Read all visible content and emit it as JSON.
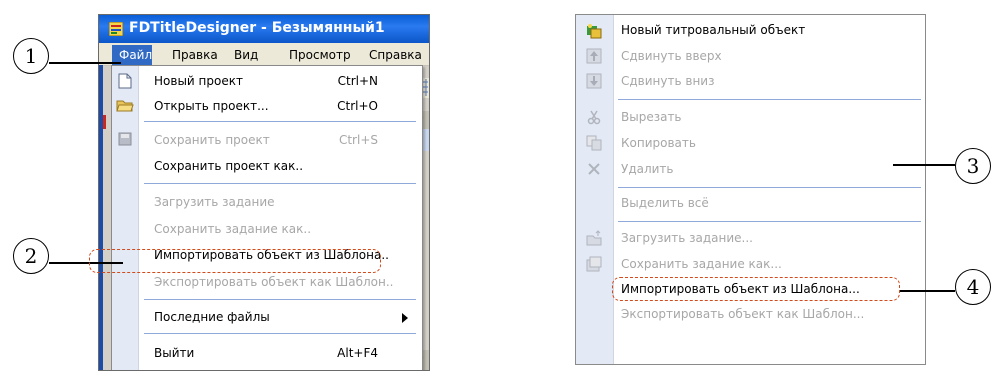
{
  "left_window": {
    "title": "FDTitleDesigner - Безымянный1",
    "menubar": [
      "Файл",
      "Правка",
      "Вид",
      "Просмотр",
      "Справка"
    ],
    "menu": [
      {
        "label": "Новый проект",
        "shortcut": "Ctrl+N",
        "disabled": false,
        "icon": "new-document-icon"
      },
      {
        "label": "Открыть проект...",
        "shortcut": "Ctrl+O",
        "disabled": false,
        "icon": "open-folder-icon"
      },
      {
        "label": "Сохранить проект",
        "shortcut": "Ctrl+S",
        "disabled": true,
        "icon": "save-disk-icon"
      },
      {
        "label": "Сохранить проект как..",
        "shortcut": "",
        "disabled": false
      },
      {
        "label": "Загрузить задание",
        "shortcut": "",
        "disabled": true
      },
      {
        "label": "Сохранить задание как..",
        "shortcut": "",
        "disabled": true
      },
      {
        "label": "Импортировать объект из Шаблона..",
        "shortcut": "",
        "disabled": false
      },
      {
        "label": "Экспортировать объект как Шаблон..",
        "shortcut": "",
        "disabled": true
      },
      {
        "label": "Последние файлы",
        "shortcut": "",
        "disabled": false,
        "submenu": true
      },
      {
        "label": "Выйти",
        "shortcut": "Alt+F4",
        "disabled": false
      }
    ]
  },
  "right_menu": [
    {
      "label": "Новый титровальный объект",
      "disabled": false,
      "icon": "new-object-icon"
    },
    {
      "label": "Сдвинуть вверх",
      "disabled": true,
      "icon": "move-up-icon"
    },
    {
      "label": "Сдвинуть вниз",
      "disabled": true,
      "icon": "move-down-icon"
    },
    {
      "label": "Вырезать",
      "disabled": true,
      "icon": "cut-icon"
    },
    {
      "label": "Копировать",
      "disabled": true,
      "icon": "copy-icon"
    },
    {
      "label": "Удалить",
      "disabled": true,
      "icon": "delete-icon"
    },
    {
      "label": "Выделить всё",
      "disabled": true
    },
    {
      "label": "Загрузить задание...",
      "disabled": true,
      "icon": "load-task-icon"
    },
    {
      "label": "Сохранить задание как...",
      "disabled": true,
      "icon": "save-task-icon"
    },
    {
      "label": "Импортировать объект из Шаблона...",
      "disabled": false
    },
    {
      "label": "Экспортировать объект как Шаблон...",
      "disabled": true
    }
  ],
  "callouts": [
    "1",
    "2",
    "3",
    "4"
  ],
  "colors": {
    "highlight": "#d2491a",
    "menu_select": "#316ac5",
    "titlebar": "#0a5ed6"
  }
}
